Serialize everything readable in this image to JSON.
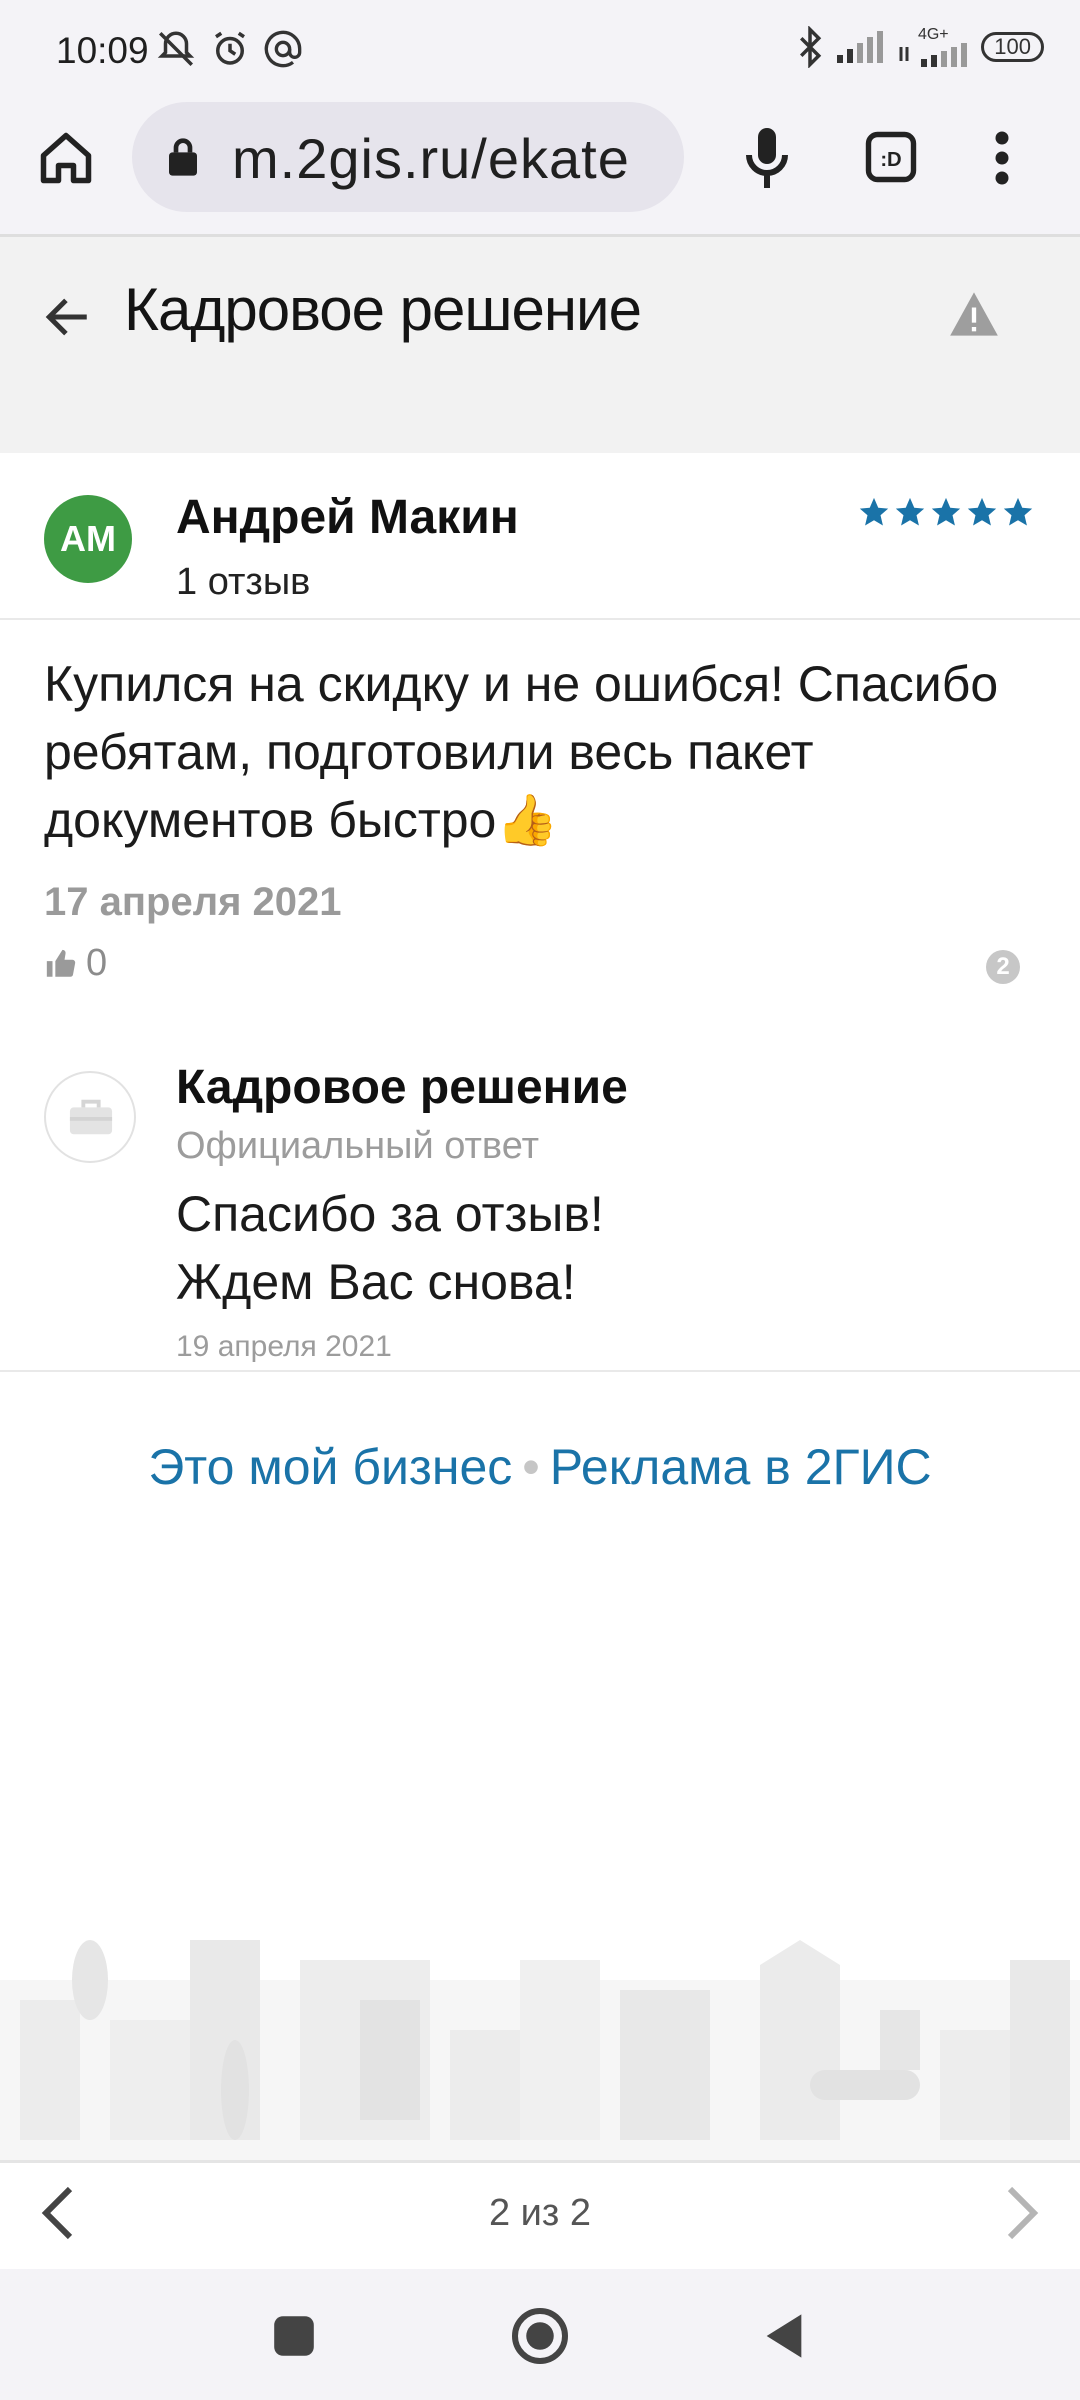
{
  "status_bar": {
    "time": "10:09",
    "network": "4G+",
    "battery": "100"
  },
  "browser": {
    "url": "m.2gis.ru/ekate"
  },
  "header": {
    "title": "Кадровое решение"
  },
  "review": {
    "avatar_initials": "AM",
    "author": "Андрей Макин",
    "review_count": "1 отзыв",
    "rating": 5,
    "text": "Купился на скидку и не ошибся! Спасибо ребятам, подготовили весь пакет документов быстро",
    "emoji": "👍",
    "date": "17 апреля 2021",
    "likes": "0",
    "question_badge": "2"
  },
  "reply": {
    "business_name": "Кадровое решение",
    "label": "Официальный ответ",
    "line1": "Спасибо за отзыв!",
    "line2": "Ждем Вас снова!",
    "date": "19 апреля 2021"
  },
  "footer_links": {
    "my_business": "Это мой бизнес",
    "separator": "•",
    "advertising": "Реклама в 2ГИС"
  },
  "pager": {
    "text": "2 из 2"
  },
  "colors": {
    "accent": "#1a73a8",
    "avatar_green": "#3e9b44",
    "star": "#1a73a8"
  }
}
